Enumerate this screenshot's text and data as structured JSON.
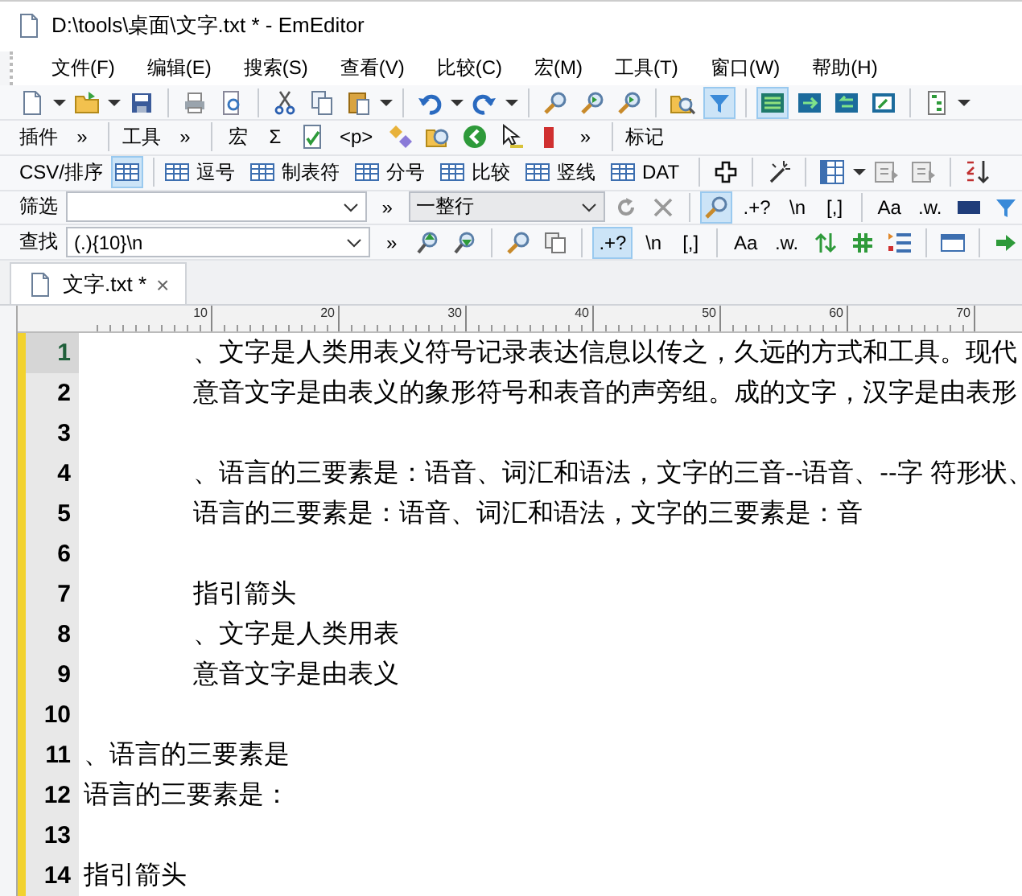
{
  "window": {
    "title": "D:\\tools\\桌面\\文字.txt * - EmEditor"
  },
  "menu": [
    {
      "label": "文件(F)"
    },
    {
      "label": "编辑(E)"
    },
    {
      "label": "搜索(S)"
    },
    {
      "label": "查看(V)"
    },
    {
      "label": "比较(C)"
    },
    {
      "label": "宏(M)"
    },
    {
      "label": "工具(T)"
    },
    {
      "label": "窗口(W)"
    },
    {
      "label": "帮助(H)"
    }
  ],
  "toolbars": [
    {
      "items": [
        {
          "kind": "icon",
          "on": false
        },
        {
          "kind": "dropdown"
        },
        {
          "kind": "icon",
          "on": false
        },
        {
          "kind": "dropdown"
        },
        {
          "kind": "icon",
          "on": false
        },
        {
          "kind": "sep"
        },
        {
          "kind": "icon",
          "on": false
        },
        {
          "kind": "icon",
          "on": false
        },
        {
          "kind": "sep"
        },
        {
          "kind": "icon",
          "on": false
        },
        {
          "kind": "icon",
          "on": false
        },
        {
          "kind": "icon",
          "on": false
        },
        {
          "kind": "dropdown"
        },
        {
          "kind": "sep"
        },
        {
          "kind": "icon",
          "on": false
        },
        {
          "kind": "dropdown"
        },
        {
          "kind": "icon",
          "on": false
        },
        {
          "kind": "dropdown"
        },
        {
          "kind": "sep"
        },
        {
          "kind": "icon",
          "on": false
        },
        {
          "kind": "icon",
          "on": false
        },
        {
          "kind": "icon",
          "on": false
        },
        {
          "kind": "sep"
        },
        {
          "kind": "icon",
          "on": false
        },
        {
          "kind": "icon",
          "on": true
        },
        {
          "kind": "sep"
        },
        {
          "kind": "icon",
          "on": true
        },
        {
          "kind": "icon",
          "on": false
        },
        {
          "kind": "icon",
          "on": false
        },
        {
          "kind": "icon",
          "on": false
        },
        {
          "kind": "sep"
        },
        {
          "kind": "icon",
          "on": false
        },
        {
          "kind": "dropdown"
        }
      ]
    },
    {
      "items": [
        {
          "kind": "label",
          "label": "插件"
        },
        {
          "kind": "button",
          "label": "»"
        },
        {
          "kind": "sep"
        },
        {
          "kind": "label",
          "label": "工具"
        },
        {
          "kind": "button",
          "label": "»"
        },
        {
          "kind": "sep"
        },
        {
          "kind": "button",
          "label": "宏"
        },
        {
          "kind": "button",
          "label": "Σ"
        },
        {
          "kind": "icon",
          "on": false
        },
        {
          "kind": "button",
          "label": "<p>"
        },
        {
          "kind": "icon",
          "on": false
        },
        {
          "kind": "icon",
          "on": false
        },
        {
          "kind": "icon",
          "on": false
        },
        {
          "kind": "icon",
          "on": false
        },
        {
          "kind": "icon",
          "on": false
        },
        {
          "kind": "button",
          "label": "»"
        },
        {
          "kind": "sep"
        },
        {
          "kind": "label",
          "label": "标记"
        }
      ]
    },
    {
      "items": [
        {
          "kind": "label",
          "label": "CSV/排序"
        },
        {
          "kind": "icon",
          "on": true
        },
        {
          "kind": "sep"
        },
        {
          "kind": "tool",
          "label": "逗号"
        },
        {
          "kind": "tool",
          "label": "制表符"
        },
        {
          "kind": "tool",
          "label": "分号"
        },
        {
          "kind": "tool",
          "label": "比较"
        },
        {
          "kind": "tool",
          "label": "竖线"
        },
        {
          "kind": "tool",
          "label": "DAT"
        },
        {
          "kind": "sep"
        },
        {
          "kind": "icon",
          "on": false
        },
        {
          "kind": "sep"
        },
        {
          "kind": "icon",
          "on": false
        },
        {
          "kind": "sep"
        },
        {
          "kind": "icon",
          "on": false
        },
        {
          "kind": "dropdown"
        },
        {
          "kind": "icon",
          "on": false
        },
        {
          "kind": "icon",
          "on": false
        },
        {
          "kind": "sep"
        },
        {
          "kind": "icon",
          "on": false
        }
      ]
    },
    {
      "items": [
        {
          "kind": "label",
          "label": "筛选"
        },
        {
          "kind": "combo",
          "editable": true
        },
        {
          "kind": "button",
          "label": "»"
        },
        {
          "kind": "combo",
          "editable": false,
          "value": "一整行"
        },
        {
          "kind": "icon",
          "on": false
        },
        {
          "kind": "icon",
          "on": false
        },
        {
          "kind": "sep"
        },
        {
          "kind": "icon",
          "on": true
        },
        {
          "kind": "button",
          "label": ".+?",
          "on": false
        },
        {
          "kind": "button",
          "label": "\\n",
          "on": false
        },
        {
          "kind": "button",
          "label": "[,]",
          "on": false
        },
        {
          "kind": "sep"
        },
        {
          "kind": "button",
          "label": "Aa",
          "on": false
        },
        {
          "kind": "button",
          "label": ".w.",
          "on": false
        },
        {
          "kind": "icon",
          "on": false
        },
        {
          "kind": "icon",
          "on": false
        }
      ]
    },
    {
      "items": [
        {
          "kind": "label",
          "label": "查找"
        },
        {
          "kind": "combo",
          "editable": true,
          "value": "(.){10}\\n"
        },
        {
          "kind": "button",
          "label": "»"
        },
        {
          "kind": "icon",
          "on": false
        },
        {
          "kind": "icon",
          "on": false
        },
        {
          "kind": "sep"
        },
        {
          "kind": "icon",
          "on": false
        },
        {
          "kind": "icon",
          "on": false
        },
        {
          "kind": "sep"
        },
        {
          "kind": "button",
          "label": ".+?",
          "on": true
        },
        {
          "kind": "button",
          "label": "\\n",
          "on": false
        },
        {
          "kind": "button",
          "label": "[,]",
          "on": false
        },
        {
          "kind": "sep"
        },
        {
          "kind": "button",
          "label": "Aa",
          "on": false
        },
        {
          "kind": "button",
          "label": ".w.",
          "on": false
        },
        {
          "kind": "icon",
          "on": false
        },
        {
          "kind": "icon",
          "on": false
        },
        {
          "kind": "icon",
          "on": false
        },
        {
          "kind": "sep"
        },
        {
          "kind": "icon",
          "on": false
        },
        {
          "kind": "sep"
        },
        {
          "kind": "icon",
          "on": false
        }
      ]
    }
  ],
  "tabs": [
    {
      "label": "文字.txt *",
      "selected": true,
      "close": "×"
    }
  ],
  "ruler": {
    "labels": [
      "10",
      "20",
      "30",
      "40",
      "50",
      "60",
      "70"
    ]
  },
  "editor": {
    "lines": [
      {
        "number": "1",
        "text": "\t、文字是人类用表义符号记录表达信息以传之，久远的方式和工具。现代",
        "current": true
      },
      {
        "number": "2",
        "text": "\t意音文字是由表义的象形符号和表音的声旁组。成的文字，汉字是由表形",
        "current": false
      },
      {
        "number": "3",
        "current": false
      },
      {
        "number": "4",
        "text": "\t、语言的三要素是：语音、词汇和语法，文字的三音--语音、--字 符形状、",
        "current": false
      },
      {
        "number": "5",
        "text": "\t语言的三要素是：语音、词汇和语法，文字的三要素是：音",
        "current": false
      },
      {
        "number": "6",
        "current": false
      },
      {
        "number": "7",
        "text": "\t指引箭头",
        "current": false
      },
      {
        "number": "8",
        "text": "\t、文字是人类用表",
        "current": false
      },
      {
        "number": "9",
        "text": "\t意音文字是由表义",
        "current": false
      },
      {
        "number": "10",
        "current": false
      },
      {
        "number": "11",
        "text": "、语言的三要素是",
        "current": false
      },
      {
        "number": "12",
        "text": "语言的三要素是：",
        "current": false
      },
      {
        "number": "13",
        "current": false
      },
      {
        "number": "14",
        "text": "指引箭头",
        "current": false
      }
    ]
  }
}
